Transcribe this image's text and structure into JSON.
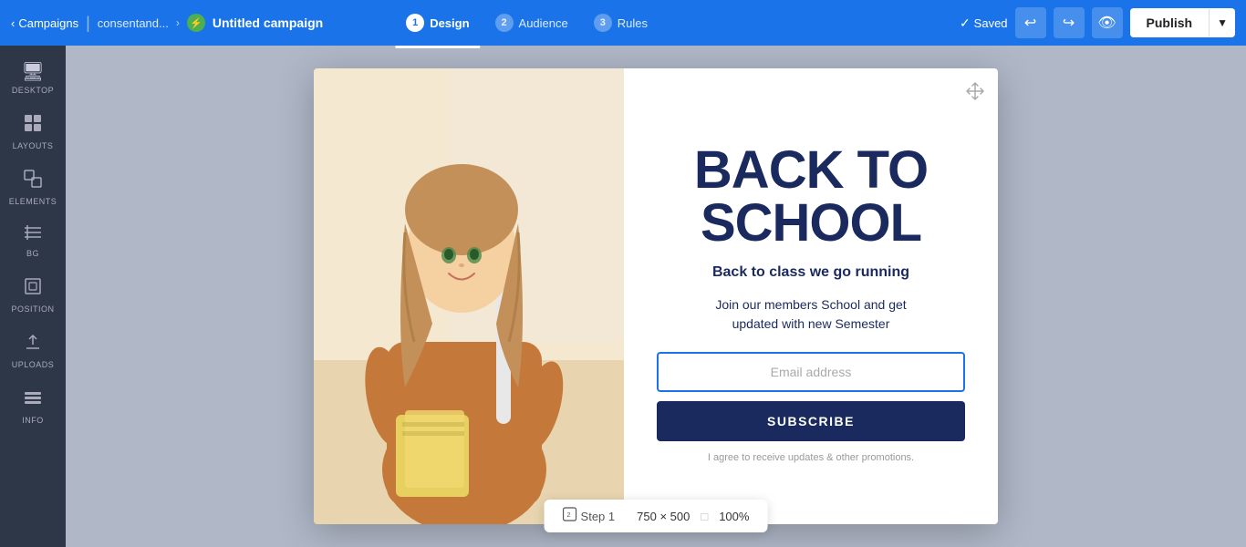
{
  "topnav": {
    "back_label": "Campaigns",
    "breadcrumb": "consentand...",
    "campaign_title": "Untitled campaign",
    "steps": [
      {
        "num": "1",
        "label": "Design",
        "active": true
      },
      {
        "num": "2",
        "label": "Audience",
        "active": false
      },
      {
        "num": "3",
        "label": "Rules",
        "active": false
      }
    ],
    "saved_label": "Saved",
    "publish_label": "Publish"
  },
  "sidebar": {
    "items": [
      {
        "id": "desktop",
        "icon": "🖥",
        "label": "DESKTOP"
      },
      {
        "id": "layouts",
        "icon": "⊞",
        "label": "LAYOUTS"
      },
      {
        "id": "elements",
        "icon": "◱",
        "label": "ELEMENTS"
      },
      {
        "id": "bg",
        "icon": "▤",
        "label": "BG"
      },
      {
        "id": "position",
        "icon": "⬚",
        "label": "POSITION"
      },
      {
        "id": "uploads",
        "icon": "⬆",
        "label": "UPLOADS"
      },
      {
        "id": "info",
        "icon": "⌨",
        "label": "INFO"
      }
    ]
  },
  "popup": {
    "title_line1": "BACK TO",
    "title_line2": "SCHOOL",
    "subtitle1": "Back to class we go running",
    "subtitle2": "Join our members School and get\nupdated with new Semester",
    "email_placeholder": "Email address",
    "subscribe_label": "SUBSCRIBE",
    "agree_text": "I agree to receive updates & other promotions."
  },
  "bottombar": {
    "step_label": "Step 1",
    "size_label": "750 × 500",
    "zoom_label": "100%"
  }
}
